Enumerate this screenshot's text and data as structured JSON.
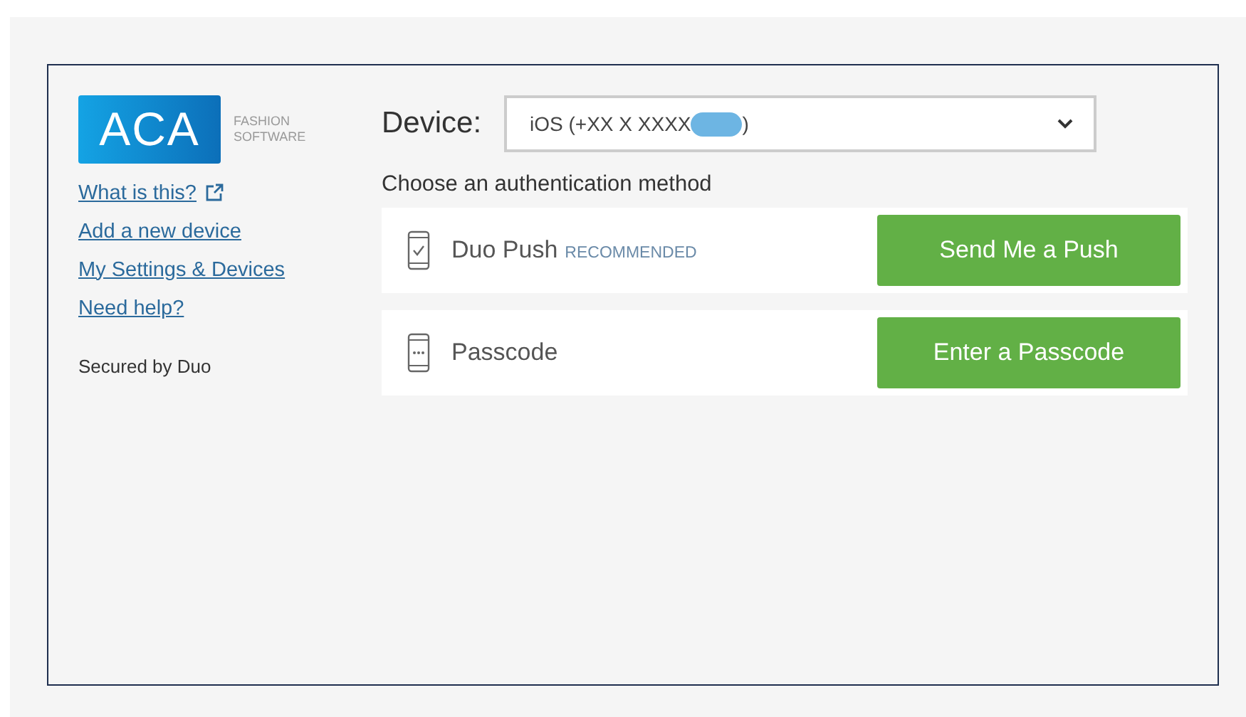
{
  "logo": {
    "mark": "ACA",
    "tagline_1": "FASHION",
    "tagline_2": "SOFTWARE"
  },
  "links": [
    {
      "label": "What is this?",
      "external": true
    },
    {
      "label": "Add a new device",
      "external": false
    },
    {
      "label": "My Settings & Devices",
      "external": false
    },
    {
      "label": "Need help?",
      "external": false
    }
  ],
  "secured_by": "Secured by Duo",
  "device": {
    "label": "Device:",
    "value_start": "iOS (+XX X XXXX",
    "value_end": ")",
    "redacted": true
  },
  "prompt": "Choose an authentication method",
  "methods": [
    {
      "kind": "push",
      "name": "Duo Push",
      "badge": "RECOMMENDED",
      "button": "Send Me a Push"
    },
    {
      "kind": "passcode",
      "name": "Passcode",
      "button": "Enter a Passcode"
    }
  ]
}
